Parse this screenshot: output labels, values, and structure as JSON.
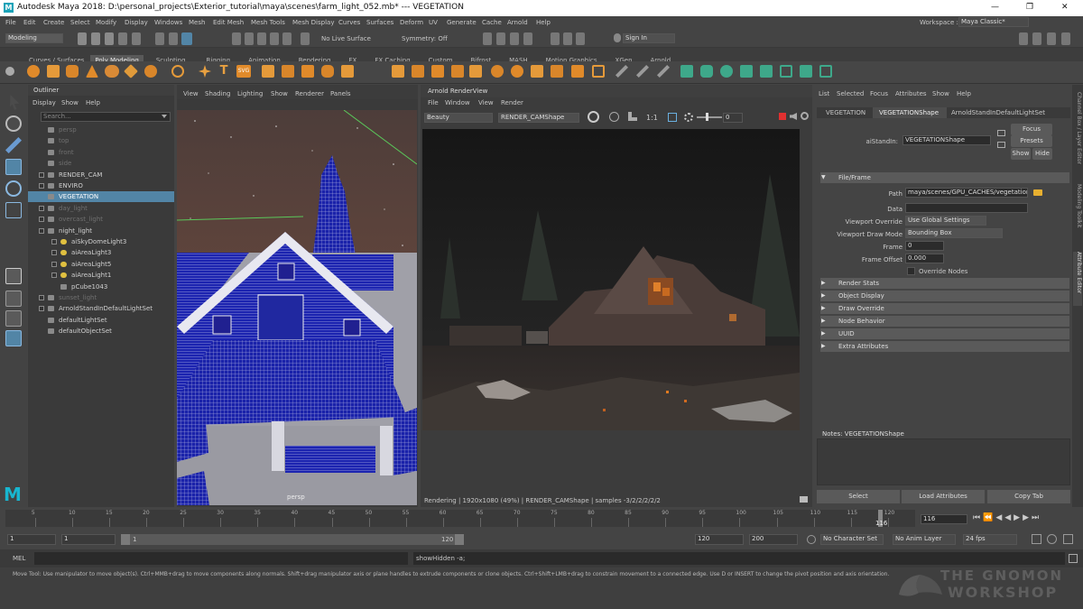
{
  "app": {
    "title": "Autodesk Maya 2018: D:\\personal_projects\\Exterior_tutorial\\maya\\scenes\\farm_light_052.mb*   ---   VEGETATION",
    "window_controls": [
      "—",
      "❐",
      "✕"
    ]
  },
  "menus": [
    "File",
    "Edit",
    "Create",
    "Select",
    "Modify",
    "Display",
    "Windows",
    "Mesh",
    "Edit Mesh",
    "Mesh Tools",
    "Mesh Display",
    "Curves",
    "Surfaces",
    "Deform",
    "UV",
    "Generate",
    "Cache",
    "Arnold",
    "Help"
  ],
  "workspace": {
    "label": "Workspace :",
    "value": "Maya Classic*"
  },
  "statusline": {
    "mode": "Modeling",
    "live_surface": "No Live Surface",
    "symmetry": "Symmetry: Off",
    "sign_in": "Sign In"
  },
  "shelf_tabs": [
    "Curves / Surfaces",
    "Poly Modeling",
    "Sculpting",
    "Rigging",
    "Animation",
    "Rendering",
    "FX",
    "FX Caching",
    "Custom",
    "Bifrost",
    "MASH",
    "Motion Graphics",
    "XGen",
    "Arnold"
  ],
  "shelf_active": "Poly Modeling",
  "outliner": {
    "title": "Outliner",
    "menu": [
      "Display",
      "Show",
      "Help"
    ],
    "search_placeholder": "Search...",
    "items": [
      {
        "label": "persp",
        "dim": true,
        "exp": false
      },
      {
        "label": "top",
        "dim": true,
        "exp": false
      },
      {
        "label": "front",
        "dim": true,
        "exp": false
      },
      {
        "label": "side",
        "dim": true,
        "exp": false
      },
      {
        "label": "RENDER_CAM",
        "dim": false,
        "exp": true
      },
      {
        "label": "ENVIRO",
        "dim": false,
        "exp": true
      },
      {
        "label": "VEGETATION",
        "dim": false,
        "exp": false,
        "selected": true
      },
      {
        "label": "day_light",
        "dim": true,
        "exp": true
      },
      {
        "label": "overcast_light",
        "dim": true,
        "exp": true
      },
      {
        "label": "night_light",
        "dim": false,
        "exp": true,
        "open": true
      },
      {
        "label": "aiSkyDomeLight3",
        "dim": false,
        "exp": true,
        "child": true
      },
      {
        "label": "aiAreaLight3",
        "dim": false,
        "exp": true,
        "child": true
      },
      {
        "label": "aiAreaLight5",
        "dim": false,
        "exp": true,
        "child": true
      },
      {
        "label": "aiAreaLight1",
        "dim": false,
        "exp": true,
        "child": true
      },
      {
        "label": "pCube1043",
        "dim": false,
        "exp": false,
        "child": true
      },
      {
        "label": "sunset_light",
        "dim": true,
        "exp": true
      },
      {
        "label": "ArnoldStandInDefaultLightSet",
        "dim": false,
        "exp": true
      },
      {
        "label": "defaultLightSet",
        "dim": false,
        "exp": false
      },
      {
        "label": "defaultObjectSet",
        "dim": false,
        "exp": false
      }
    ]
  },
  "viewport": {
    "menu": [
      "View",
      "Shading",
      "Lighting",
      "Show",
      "Renderer",
      "Panels"
    ],
    "camera_label": "persp"
  },
  "renderview": {
    "title": "Arnold RenderView",
    "menu": [
      "File",
      "Window",
      "View",
      "Render"
    ],
    "aov": "Beauty",
    "camera": "RENDER_CAMShape",
    "ratio": "1:1",
    "exposure": "0",
    "status": "Rendering | 1920x1080 (49%) | RENDER_CAMShape | samples -3/2/2/2/2/2"
  },
  "attr": {
    "menu": [
      "List",
      "Selected",
      "Focus",
      "Attributes",
      "Show",
      "Help"
    ],
    "tabs": [
      "VEGETATION",
      "VEGETATIONShape",
      "ArnoldStandInDefaultLightSet"
    ],
    "active_tab": "VEGETATIONShape",
    "node_label": "aiStandIn:",
    "node_value": "VEGETATIONShape",
    "side_buttons": [
      "Focus",
      "Presets",
      "Show",
      "Hide"
    ],
    "file_section": "File/Frame",
    "path_label": "Path",
    "path_value": "maya/scenes/GPU_CACHES/vegetation.ass",
    "data_label": "Data",
    "data_value": "",
    "vo_label": "Viewport Override",
    "vo_value": "Use Global Settings",
    "vdm_label": "Viewport Draw Mode",
    "vdm_value": "Bounding Box",
    "frame_label": "Frame",
    "frame_value": "0",
    "offset_label": "Frame Offset",
    "offset_value": "0.000",
    "override_label": "Override Nodes",
    "sections": [
      "Render Stats",
      "Object Display",
      "Draw Override",
      "Node Behavior",
      "UUID",
      "Extra Attributes"
    ],
    "notes_label": "Notes:  VEGETATIONShape",
    "buttons": [
      "Select",
      "Load Attributes",
      "Copy Tab"
    ]
  },
  "timeline": {
    "ticks": [
      "5",
      "10",
      "15",
      "20",
      "25",
      "30",
      "35",
      "40",
      "45",
      "50",
      "55",
      "60",
      "65",
      "70",
      "75",
      "80",
      "85",
      "90",
      "95",
      "100",
      "105",
      "110",
      "115",
      "120"
    ],
    "current": "116",
    "current_field": "116"
  },
  "range": {
    "start": "1",
    "start2": "1",
    "slider_start": "1",
    "slider_end": "120",
    "end": "120",
    "end2": "200",
    "char_set": "No Character Set",
    "anim_layer": "No Anim Layer",
    "fps": "24 fps"
  },
  "mel": {
    "label": "MEL",
    "result": "showHidden -a;"
  },
  "help_text": "Move Tool: Use manipulator to move object(s). Ctrl+MMB+drag to move components along normals. Shift+drag manipulator axis or plane handles to extrude components or clone objects. Ctrl+Shift+LMB+drag to constrain movement to a connected edge. Use D or INSERT to change the pivot position and axis orientation.",
  "watermark": {
    "line1": "THE GNOMON",
    "line2": "WORKSHOP"
  },
  "right_strip": [
    "Channel Box / Layer Editor",
    "Modeling Toolkit",
    "Attribute Editor"
  ],
  "colors": {
    "selection": "#5285a6",
    "wire": "#1a20a8",
    "accent": "#f0a040",
    "render_bg": "#1a1a1a"
  }
}
